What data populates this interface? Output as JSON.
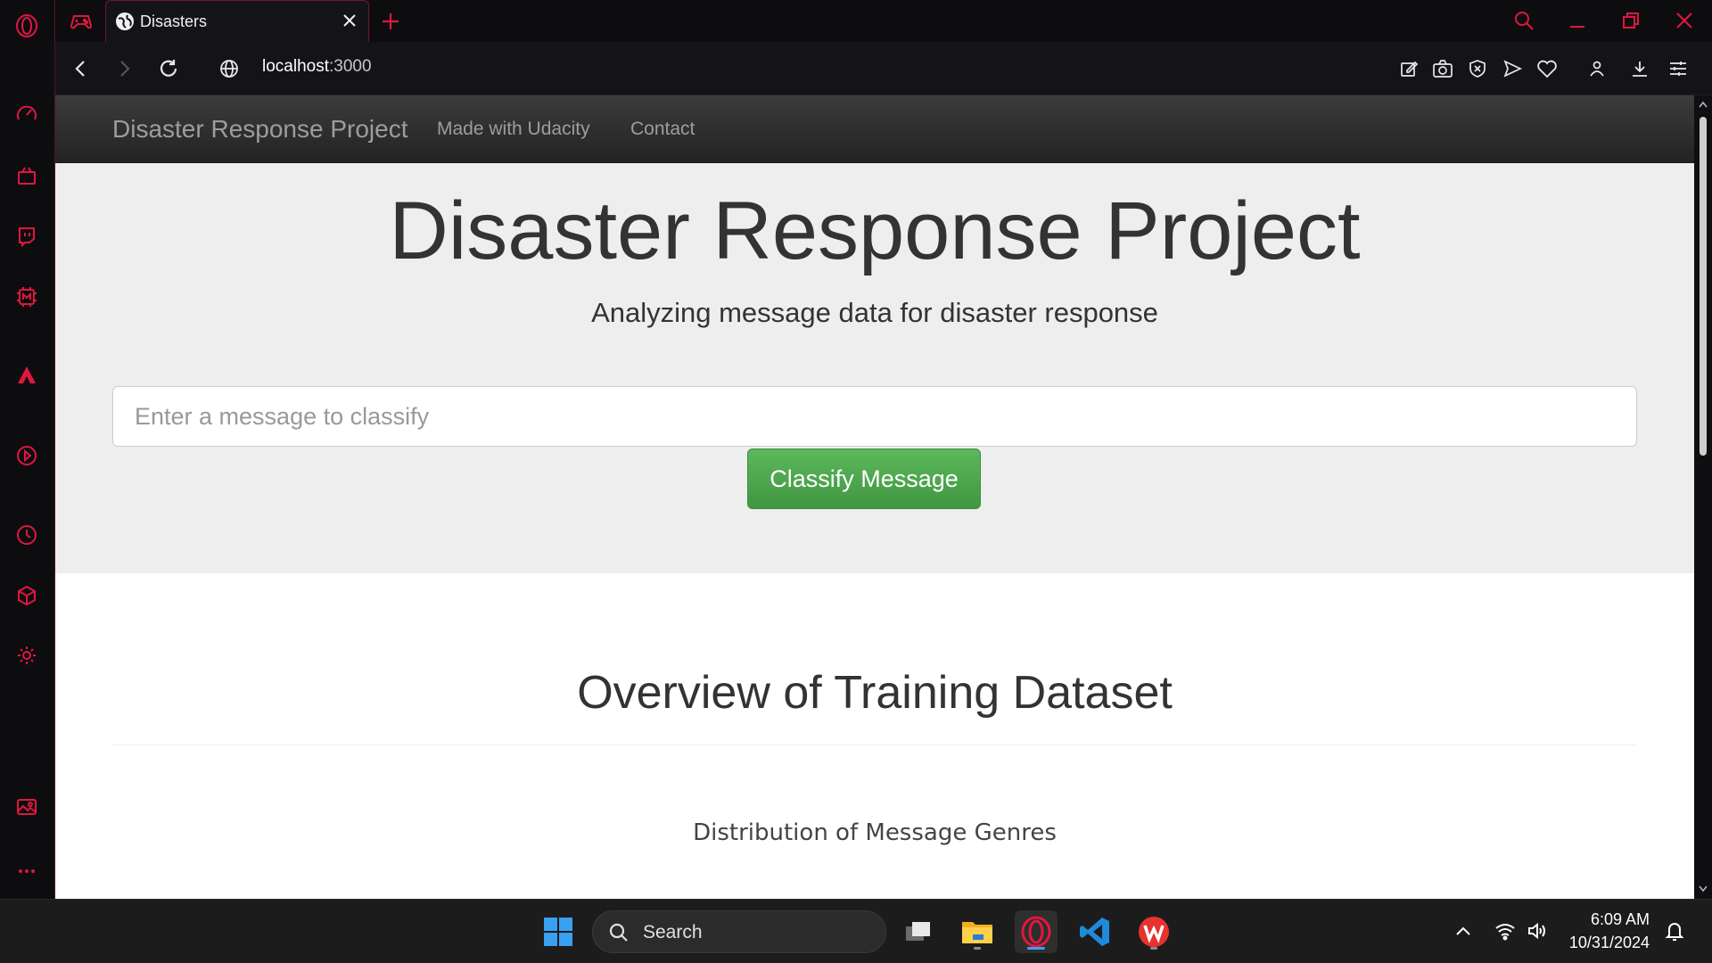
{
  "browser": {
    "tab_title": "Disasters",
    "url_host": "localhost",
    "url_port": ":3000",
    "accent_color": "#e0173f"
  },
  "page": {
    "navbar": {
      "brand": "Disaster Response Project",
      "links": [
        "Made with Udacity",
        "Contact"
      ]
    },
    "jumbotron": {
      "title": "Disaster Response Project",
      "subtitle": "Analyzing message data for disaster response",
      "input_placeholder": "Enter a message to classify",
      "button_label": "Classify Message"
    },
    "overview_title": "Overview of Training Dataset",
    "chart_title": "Distribution of Message Genres"
  },
  "taskbar": {
    "search_label": "Search",
    "time": "6:09 AM",
    "date": "10/31/2024"
  },
  "icons": {
    "sidebar": [
      "opera-logo-icon",
      "speed-dial-icon",
      "shopping-icon",
      "twitch-icon",
      "memory-icon",
      "aria-icon",
      "player-icon",
      "history-icon",
      "extensions-icon",
      "settings-icon",
      "gallery-icon",
      "more-icon"
    ]
  }
}
